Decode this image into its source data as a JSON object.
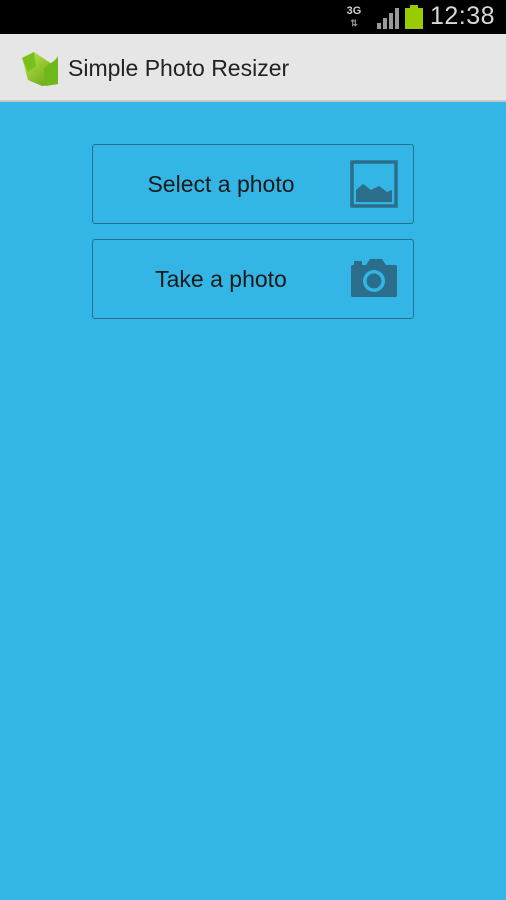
{
  "status_bar": {
    "network": "3G",
    "time": "12:38",
    "battery_color": "#99cc00"
  },
  "action_bar": {
    "title": "Simple Photo Resizer",
    "icon": "app-logo-icon"
  },
  "buttons": {
    "select": {
      "label": "Select a photo",
      "icon": "image-icon"
    },
    "take": {
      "label": "Take a photo",
      "icon": "camera-icon"
    }
  },
  "colors": {
    "background": "#33b5e5",
    "action_bar": "#e6e6e6",
    "icon": "#2a6e8c"
  }
}
